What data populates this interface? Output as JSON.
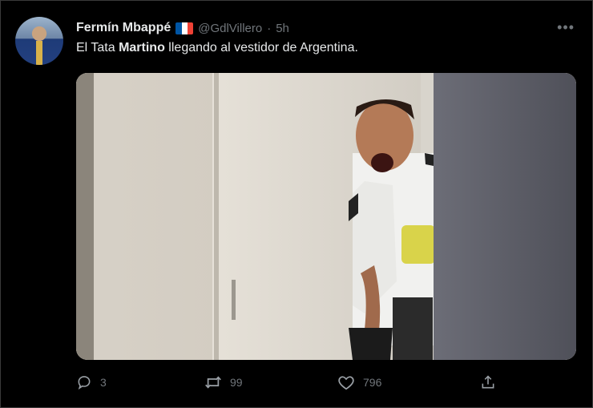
{
  "tweet": {
    "author_name": "Fermín Mbappé",
    "handle": "@GdlVillero",
    "separator": "·",
    "time": "5h",
    "more_icon": "more-horizontal-icon",
    "text_before": "El Tata ",
    "text_bold": "Martino",
    "text_after": " llegando al vestidor de Argentina.",
    "flag_colors": [
      "#0055A4",
      "#FFFFFF",
      "#EF4135"
    ]
  },
  "actions": {
    "reply_count": "3",
    "retweet_count": "99",
    "like_count": "796"
  },
  "colors": {
    "background": "#000000",
    "text_primary": "#e7e9ea",
    "text_secondary": "#71767b"
  }
}
